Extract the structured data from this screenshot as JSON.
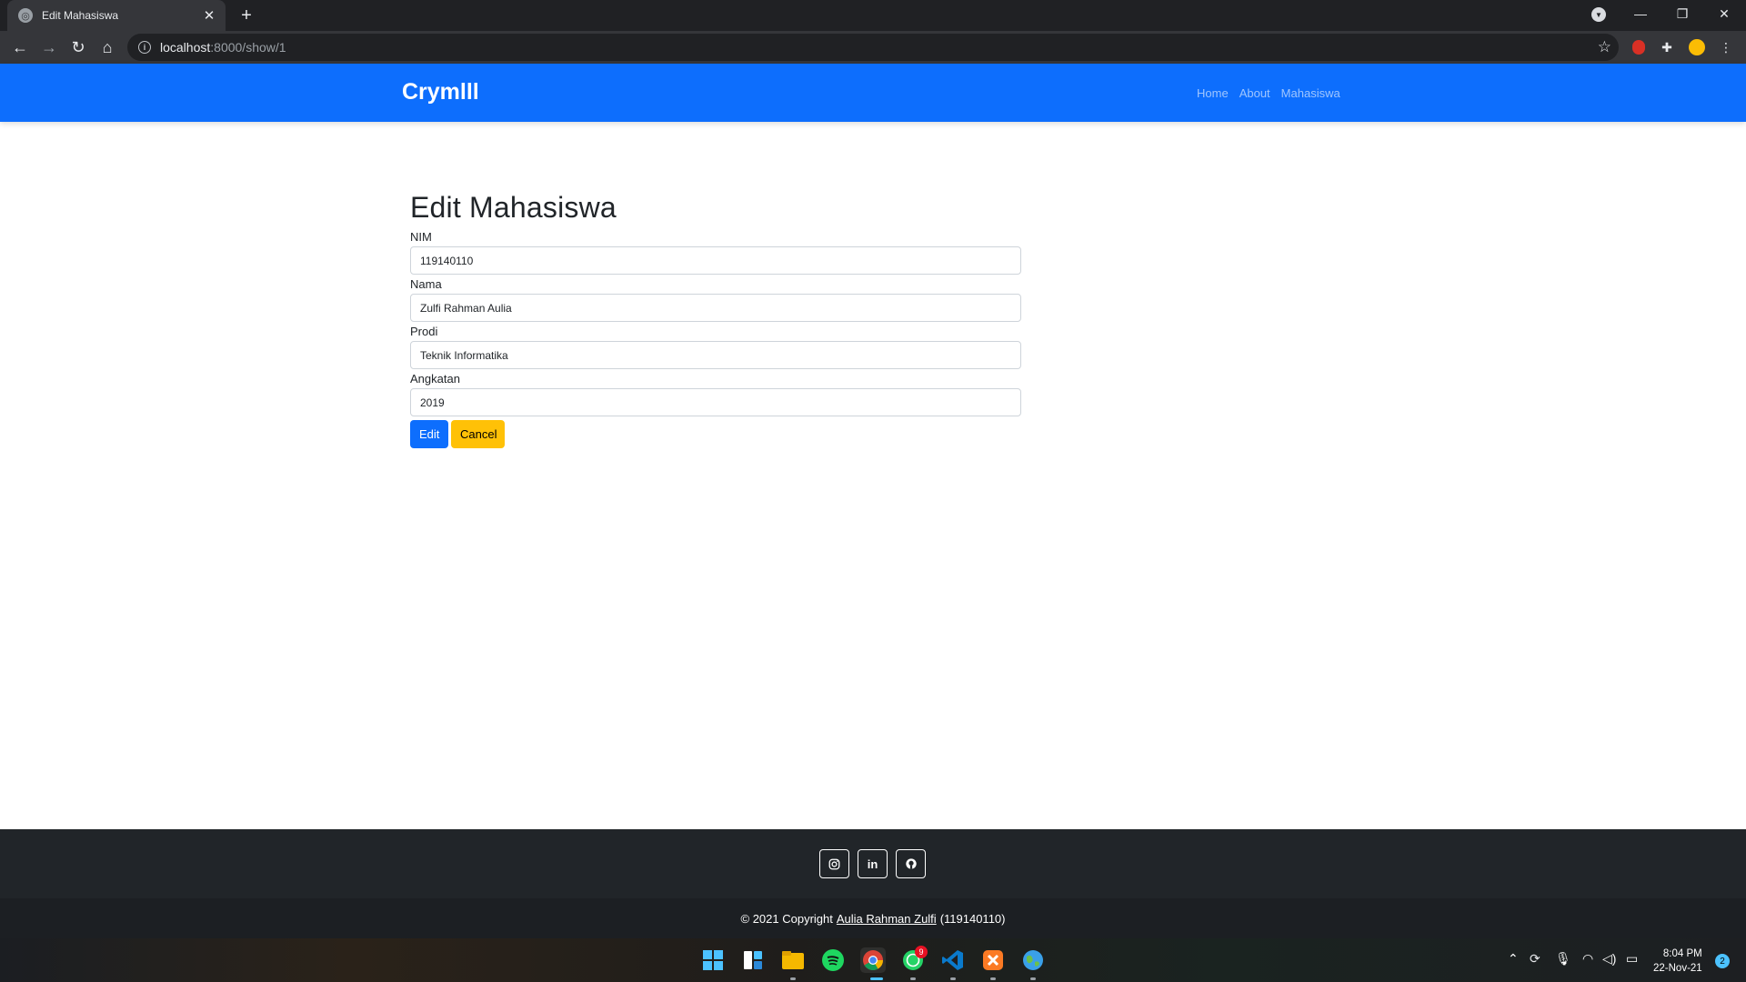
{
  "browser": {
    "tab_title": "Edit Mahasiswa",
    "tab_close": "✕",
    "new_tab": "+",
    "url_host": "localhost",
    "url_path": ":8000/show/1"
  },
  "navbar": {
    "brand": "Crymlll",
    "links": [
      "Home",
      "About",
      "Mahasiswa"
    ]
  },
  "form": {
    "title": "Edit Mahasiswa",
    "fields": [
      {
        "label": "NIM",
        "value": "119140110"
      },
      {
        "label": "Nama",
        "value": "Zulfi Rahman Aulia"
      },
      {
        "label": "Prodi",
        "value": "Teknik Informatika"
      },
      {
        "label": "Angkatan",
        "value": "2019"
      }
    ],
    "edit_label": "Edit",
    "cancel_label": "Cancel"
  },
  "footer": {
    "social": [
      "instagram-icon",
      "linkedin-icon",
      "github-icon"
    ],
    "copyright_prefix": "© 2021 Copyright",
    "author": "Aulia Rahman Zulfi",
    "nim_suffix": "(119140110)"
  },
  "taskbar": {
    "whatsapp_badge": "9",
    "time": "8:04 PM",
    "date": "22-Nov-21",
    "notifications": "2"
  },
  "colors": {
    "navbar": "#0d6efd",
    "edit_button": "#0d6efd",
    "cancel_button": "#ffc107",
    "footer": "#212529"
  }
}
